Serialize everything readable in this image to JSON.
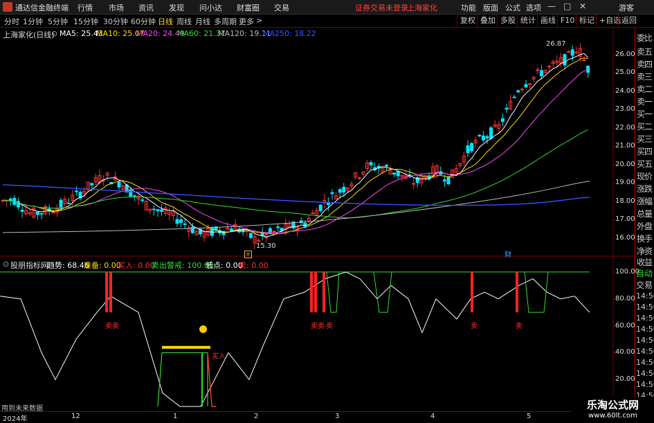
{
  "titlebar": {
    "app_name": "通达信金融终端",
    "menus": [
      "行情",
      "市场",
      "资讯",
      "发现",
      "问小达",
      "财富圈",
      "交易"
    ],
    "warning": "证券交易未登录",
    "stock_name": "上海家化",
    "tools": [
      "功能",
      "版面",
      "公式",
      "选项"
    ],
    "user": "游客"
  },
  "period_tabs": [
    "分时",
    "1分钟",
    "5分钟",
    "15分钟",
    "30分钟",
    "60分钟",
    "日线",
    "周线",
    "月线",
    "多周期",
    "更多"
  ],
  "active_period": "日线",
  "right_tabs": [
    "复权",
    "叠加",
    "多股",
    "统计",
    "画线",
    "F10",
    "标记",
    "+自选",
    "返回"
  ],
  "chart_header": {
    "title": "上海家化(日线)",
    "ma": [
      {
        "label": "MA5: 25.43",
        "color": "#ffffff"
      },
      {
        "label": "MA10: 25.07",
        "color": "#ffdd00"
      },
      {
        "label": "MA20: 24.49",
        "color": "#ff44ff"
      },
      {
        "label": "MA60: 21.37",
        "color": "#33dd33"
      },
      {
        "label": "MA120: 19.11",
        "color": "#bbbbbb"
      },
      {
        "label": "MA250: 18.22",
        "color": "#3355ff"
      }
    ]
  },
  "price_annotations": {
    "high": "26.87",
    "low": "15.30",
    "finance_mark": "财"
  },
  "right_panel": [
    "委比",
    "卖五",
    "卖四",
    "卖三",
    "卖二",
    "卖一",
    "买一",
    "买二",
    "买三",
    "买四",
    "买五",
    "现价",
    "涨跌",
    "涨幅",
    "总量",
    "外盘",
    "换手",
    "净资",
    "收益"
  ],
  "indicator_header": {
    "name": "股朋指标网",
    "items": [
      {
        "label": "趋势: 68.46",
        "color": "#ffffff"
      },
      {
        "label": "准备: 0.00",
        "color": "#ffdd00"
      },
      {
        "label": "买入: 0.00",
        "color": "#ff3333"
      },
      {
        "label": "卖出警戒: 100.00",
        "color": "#33dd33"
      },
      {
        "label": "低点: 0.00",
        "color": "#ffffff"
      },
      {
        "label": "卖: 0.00",
        "color": "#ff3333"
      }
    ]
  },
  "indicator_right": [
    "自动",
    "交易",
    "14:56",
    "14:56",
    "14:56",
    "14:56",
    "14:56",
    "14:56",
    "14:56",
    "14:56",
    "14:56",
    "14:56"
  ],
  "indicator_labels": {
    "sell": "卖",
    "sell_double": "卖卖",
    "buy": "买入",
    "note": "用到未来数据"
  },
  "x_axis": [
    "2024年",
    "12",
    "1",
    "2",
    "3",
    "4",
    "5"
  ],
  "watermark": {
    "title": "乐淘公式网",
    "url": "www.60lt.com"
  },
  "chart_data": [
    {
      "type": "line",
      "title": "上海家化(日线)",
      "y_ticks": [
        16.0,
        17.0,
        18.0,
        19.0,
        20.0,
        21.0,
        22.0,
        23.0,
        24.0,
        25.0,
        26.0
      ],
      "ylim": [
        15.2,
        27.2
      ]
    },
    {
      "type": "line",
      "title": "股朋指标网",
      "y_ticks": [
        20.0,
        40.0,
        60.0,
        80.0,
        100.0
      ],
      "ylim": [
        -2,
        102
      ]
    }
  ]
}
